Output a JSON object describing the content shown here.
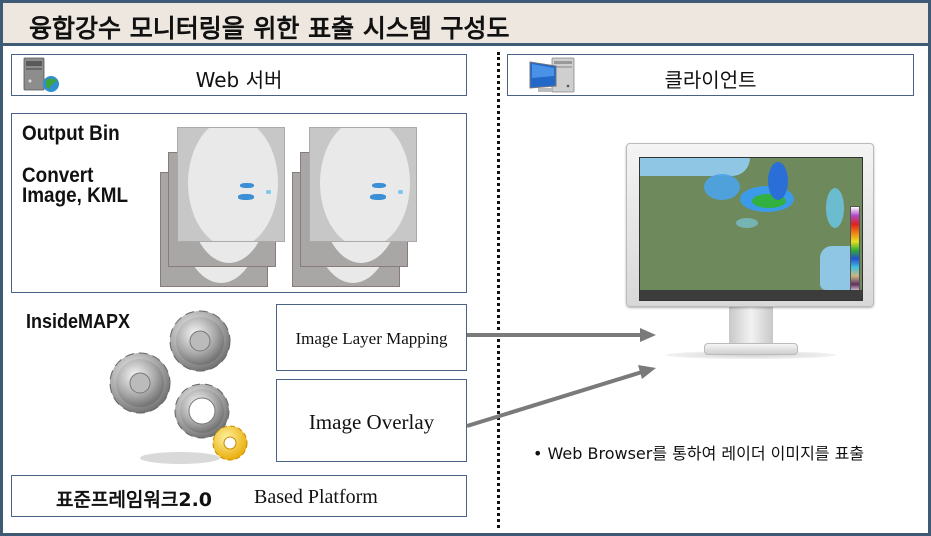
{
  "title": "융합강수 모니터링을 위한 표출 시스템 구성도",
  "server": {
    "header_label": "Web 서버",
    "output_bin_label": "Output Bin",
    "convert_label_line1": "Convert",
    "convert_label_line2": "Image, KML",
    "engine_label": "InsideMAPX",
    "image_layer_mapping_label": "Image Layer Mapping",
    "image_overlay_label": "Image Overlay",
    "framework_label": "표준프레임워크2.0",
    "platform_label": "Based Platform"
  },
  "client": {
    "header_label": "클라이언트",
    "bullet": "•",
    "description": "Web Browser를 통하여 레이더 이미지를 표출"
  },
  "icons": {
    "server": "web-server-icon",
    "client": "desktop-computer-icon",
    "gears": "gears-icon",
    "monitor": "monitor-icon"
  },
  "colors": {
    "frame_border": "#3e5a74",
    "title_bg": "#ede7df",
    "box_border": "#4a6285",
    "arrow": "#7a7a7a"
  }
}
